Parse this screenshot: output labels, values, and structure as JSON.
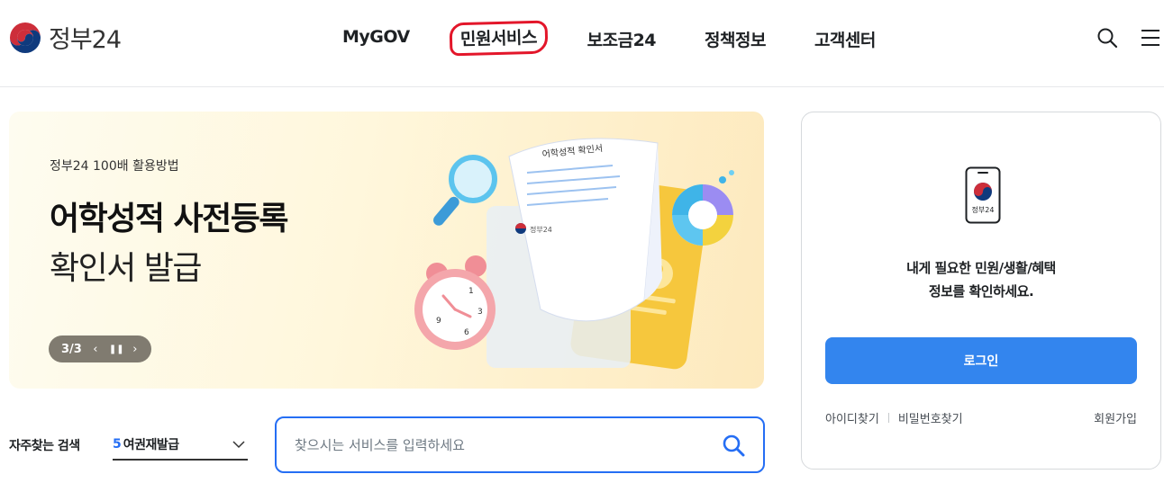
{
  "header": {
    "logo_text": "정부24",
    "nav": [
      "MyGOV",
      "민원서비스",
      "보조금24",
      "정책정보",
      "고객센터"
    ]
  },
  "banner": {
    "subtitle": "정부24 100배 활용방법",
    "title_line1": "어학성적 사전등록",
    "title_line2": "확인서 발급",
    "counter": "3/3",
    "doc_title": "어학성적 확인서",
    "doc_brand": "정부24"
  },
  "search": {
    "label": "자주찾는 검색",
    "fav_rank": "5",
    "fav_term": "여권재발급",
    "placeholder": "찾으시는 서비스를 입력하세요"
  },
  "login": {
    "phone_brand": "정부24",
    "message_line1": "내게 필요한 민원/생활/혜택",
    "message_line2": "정보를 확인하세요.",
    "button": "로그인",
    "find_id": "아이디찾기",
    "find_pw": "비밀번호찾기",
    "join": "회원가입"
  },
  "colors": {
    "accent_blue": "#256ef4",
    "login_blue": "#3385ee",
    "highlight_red": "#e3162a"
  }
}
